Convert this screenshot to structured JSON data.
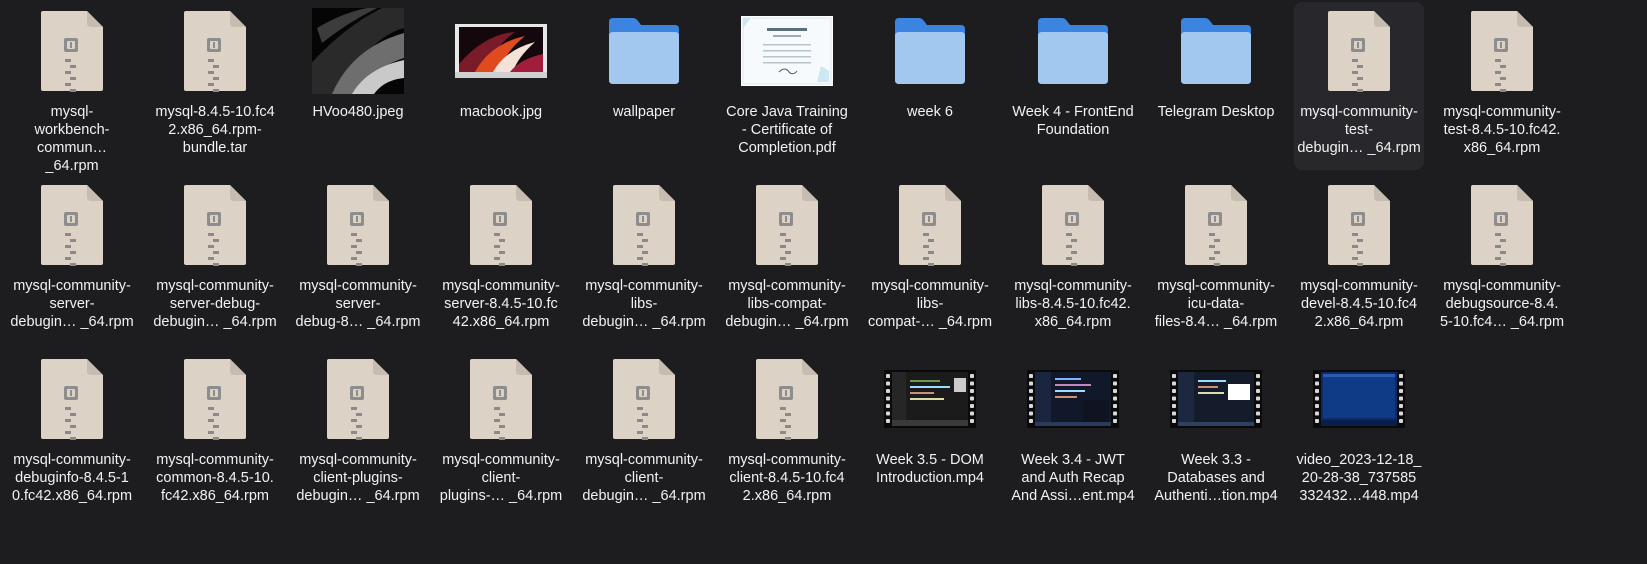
{
  "files": [
    {
      "type": "archive",
      "label": "mysql-\nworkbench-\ncommun… _64.rpm"
    },
    {
      "type": "archive",
      "label": "mysql-8.4.5-10.fc4\n2.x86_64.rpm-\nbundle.tar"
    },
    {
      "type": "image-dark",
      "label": "HVoo480.jpeg"
    },
    {
      "type": "image-macbook",
      "label": "macbook.jpg"
    },
    {
      "type": "folder",
      "label": "wallpaper"
    },
    {
      "type": "pdf",
      "label": "Core Java Training\n- Certificate of\nCompletion.pdf"
    },
    {
      "type": "folder",
      "label": "week 6"
    },
    {
      "type": "folder",
      "label": "Week 4 - FrontEnd\nFoundation"
    },
    {
      "type": "folder",
      "label": "Telegram Desktop"
    },
    {
      "type": "archive",
      "label": "mysql-community-\ntest-\ndebugin… _64.rpm",
      "hovered": true
    },
    {
      "type": "archive",
      "label": "mysql-community-\ntest-8.4.5-10.fc42.\nx86_64.rpm"
    },
    {
      "type": "archive",
      "label": "mysql-community-\nserver-\ndebugin… _64.rpm"
    },
    {
      "type": "archive",
      "label": "mysql-community-\nserver-debug-\ndebugin… _64.rpm"
    },
    {
      "type": "archive",
      "label": "mysql-community-\nserver-\ndebug-8… _64.rpm"
    },
    {
      "type": "archive",
      "label": "mysql-community-\nserver-8.4.5-10.fc\n42.x86_64.rpm"
    },
    {
      "type": "archive",
      "label": "mysql-community-\nlibs-\ndebugin… _64.rpm"
    },
    {
      "type": "archive",
      "label": "mysql-community-\nlibs-compat-\ndebugin… _64.rpm"
    },
    {
      "type": "archive",
      "label": "mysql-community-\nlibs-\ncompat-… _64.rpm"
    },
    {
      "type": "archive",
      "label": "mysql-community-\nlibs-8.4.5-10.fc42.\nx86_64.rpm"
    },
    {
      "type": "archive",
      "label": "mysql-community-\nicu-data-\nfiles-8.4… _64.rpm"
    },
    {
      "type": "archive",
      "label": "mysql-community-\ndevel-8.4.5-10.fc4\n2.x86_64.rpm"
    },
    {
      "type": "archive",
      "label": "mysql-community-\ndebugsource-8.4.\n5-10.fc4… _64.rpm"
    },
    {
      "type": "archive",
      "label": "mysql-community-\ndebuginfo-8.4.5-1\n0.fc42.x86_64.rpm"
    },
    {
      "type": "archive",
      "label": "mysql-community-\ncommon-8.4.5-10.\nfc42.x86_64.rpm"
    },
    {
      "type": "archive",
      "label": "mysql-community-\nclient-plugins-\ndebugin… _64.rpm"
    },
    {
      "type": "archive",
      "label": "mysql-community-\nclient-\nplugins-… _64.rpm"
    },
    {
      "type": "archive",
      "label": "mysql-community-\nclient-\ndebugin… _64.rpm"
    },
    {
      "type": "archive",
      "label": "mysql-community-\nclient-8.4.5-10.fc4\n2.x86_64.rpm"
    },
    {
      "type": "video",
      "variant": "editor-dark",
      "label": "Week 3.5 - DOM\nIntroduction.mp4"
    },
    {
      "type": "video",
      "variant": "editor-navy",
      "label": "Week 3.4 - JWT\nand Auth Recap\nAnd Assi…ent.mp4"
    },
    {
      "type": "video",
      "variant": "editor-window",
      "label": "Week 3.3 -\nDatabases and\nAuthenti…tion.mp4"
    },
    {
      "type": "video",
      "variant": "blue-screen",
      "label": "video_2023-12-18_\n20-28-38_737585\n332432…448.mp4"
    }
  ],
  "colors": {
    "background": "#1d1d20",
    "hover": "#28282c",
    "folder_back": "#3b84e0",
    "folder_front": "#a3c8f0",
    "archive_paper": "#ddd2c6",
    "label_text": "#f2f2f2"
  }
}
